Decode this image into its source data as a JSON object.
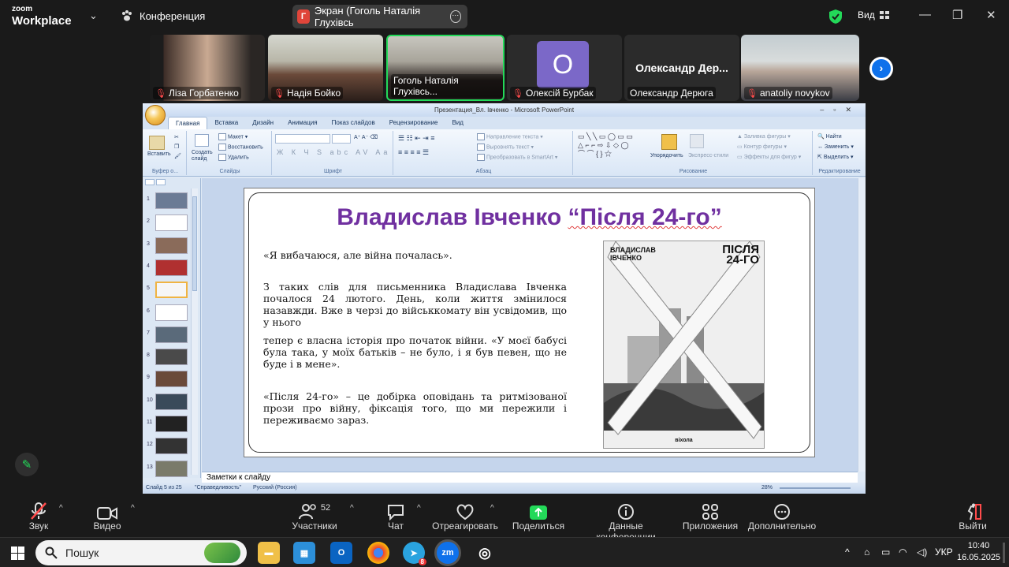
{
  "zoom": {
    "brand_top": "zoom",
    "brand_bottom": "Workplace",
    "meeting_label": "Конференция",
    "share_badge": "Г",
    "share_title": "Экран (Гоголь Наталія Глухівсь",
    "view_label": "Вид"
  },
  "participants": [
    {
      "name": "Ліза Горбатенко",
      "muted": true
    },
    {
      "name": "Надія Бойко",
      "muted": true
    },
    {
      "name": "Гоголь Наталія Глухівсь...",
      "muted": false,
      "active": true
    },
    {
      "name": "Олексій Бурбак",
      "muted": true,
      "avatar_letter": "O"
    },
    {
      "name": "Олександр Дерюга",
      "muted": false,
      "big_name": "Олександр  Дер..."
    },
    {
      "name": "anatoliy novykov",
      "muted": true
    }
  ],
  "ppt": {
    "window_title": "Презентация_Вл. Івченко - Microsoft PowerPoint",
    "tabs": [
      "Главная",
      "Вставка",
      "Дизайн",
      "Анимация",
      "Показ слайдов",
      "Рецензирование",
      "Вид"
    ],
    "ribbon": {
      "paste": "Вставить",
      "clipboard": "Буфер о...",
      "new_slide": "Создать слайд",
      "layout": "Макет",
      "reset": "Восстановить",
      "delete": "Удалить",
      "slides_group": "Слайды",
      "font_group": "Шрифт",
      "text_direction": "Направление текста",
      "align_text": "Выровнять текст",
      "smartart": "Преобразовать в SmartArt",
      "paragraph_group": "Абзац",
      "arrange": "Упорядочить",
      "quick_styles": "Экспресс-стили",
      "shape_fill": "Заливка фигуры",
      "shape_outline": "Контур фигуры",
      "shape_effects": "Эффекты для фигур",
      "drawing_group": "Рисование",
      "find": "Найти",
      "replace": "Заменить",
      "select": "Выделить",
      "editing_group": "Редактирование"
    },
    "slide_numbers": [
      "1",
      "2",
      "3",
      "4",
      "5",
      "6",
      "7",
      "8",
      "9",
      "10",
      "11",
      "12",
      "13"
    ],
    "notes_placeholder": "Заметки к слайду",
    "status": {
      "slide": "Слайд 5 из 25",
      "theme": "\"Справедливость\"",
      "lang": "Русский (Россия)",
      "zoom": "28%"
    }
  },
  "slide": {
    "title_plain": "Владислав Івченко ",
    "title_quoted": "“Після 24-го”",
    "quote": "«Я вибачаюся, але війна почалась».",
    "para1": "З таких слів для письменника Владислава Івченка почалося 24 лютого. День, коли життя змінилося назавжди. Вже в черзі до військкомату він усвідомив, що у нього",
    "para2": "тепер є власна історія про початок війни. «У моєї бабусі була така, у моїх батьків – не було, і я був певен, що не буде і в мене».",
    "para3": "«Після 24-го» – це добірка оповідань та ритмізованої прози про війну, фіксація того, що ми пережили і переживаємо зараз.",
    "book_author_1": "ВЛАДИСЛАВ",
    "book_author_2": "ІВЧЕНКО",
    "book_title_1": "ПІСЛЯ",
    "book_title_2": "24-ГО",
    "book_publisher": "віхола"
  },
  "toolbar": {
    "audio": "Звук",
    "video": "Видео",
    "participants": "Участники",
    "participants_count": "52",
    "chat": "Чат",
    "react": "Отреагировать",
    "share": "Поделиться",
    "info": "Данные конференции",
    "apps": "Приложения",
    "more": "Дополнительно",
    "leave": "Выйти"
  },
  "taskbar": {
    "search_placeholder": "Пошук",
    "telegram_badge": "8",
    "lang": "УКР",
    "time": "10:40",
    "date": "16.05.2025"
  },
  "colors": {
    "zoom_bg": "#1a1a1a",
    "zoom_green": "#23d959",
    "zoom_blue": "#0e71eb",
    "slide_title": "#7030a0"
  }
}
